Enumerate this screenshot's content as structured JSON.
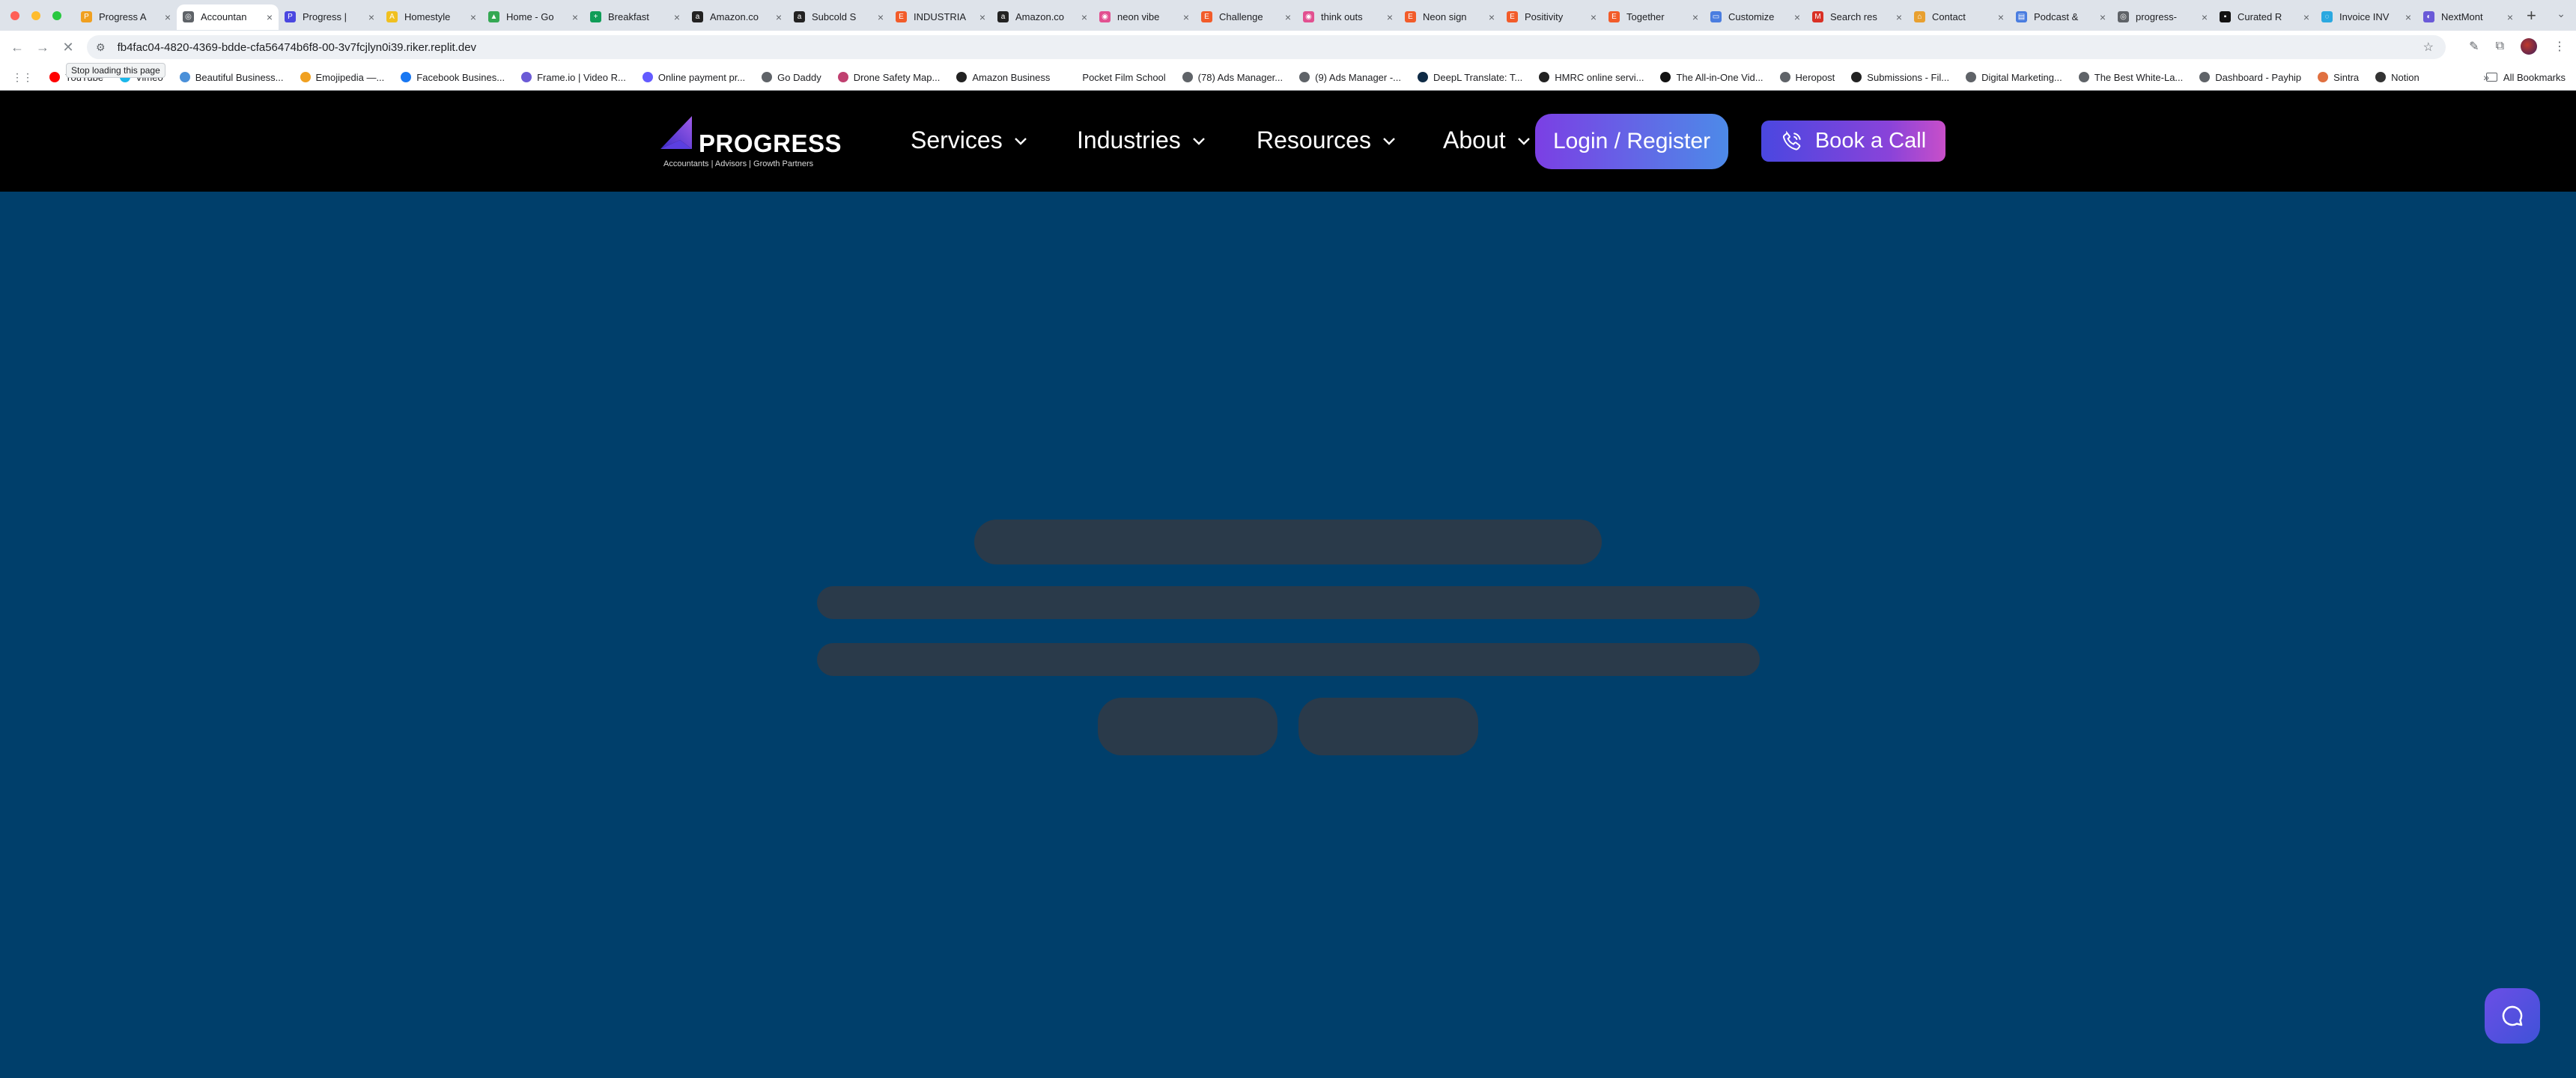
{
  "browser": {
    "tabs": [
      {
        "title": "Progress A",
        "color": "#f0a020",
        "glyph": "P"
      },
      {
        "title": "Accountan",
        "color": "#5f6368",
        "glyph": "◎",
        "active": true
      },
      {
        "title": "Progress |",
        "color": "#4a47e0",
        "glyph": "P"
      },
      {
        "title": "Homestyle",
        "color": "#f0c020",
        "glyph": "A"
      },
      {
        "title": "Home - Go",
        "color": "#34a853",
        "glyph": "▲"
      },
      {
        "title": "Breakfast",
        "color": "#0f9d58",
        "glyph": "+"
      },
      {
        "title": "Amazon.co",
        "color": "#222222",
        "glyph": "a"
      },
      {
        "title": "Subcold S",
        "color": "#222222",
        "glyph": "a"
      },
      {
        "title": "INDUSTRIA",
        "color": "#f25c2a",
        "glyph": "E"
      },
      {
        "title": "Amazon.co",
        "color": "#222222",
        "glyph": "a"
      },
      {
        "title": "neon vibe",
        "color": "#e25090",
        "glyph": "◉"
      },
      {
        "title": "Challenge",
        "color": "#f25c2a",
        "glyph": "E"
      },
      {
        "title": "think outs",
        "color": "#e25090",
        "glyph": "◉"
      },
      {
        "title": "Neon sign",
        "color": "#f25c2a",
        "glyph": "E"
      },
      {
        "title": "Positivity",
        "color": "#f25c2a",
        "glyph": "E"
      },
      {
        "title": "Together",
        "color": "#f25c2a",
        "glyph": "E"
      },
      {
        "title": "Customize",
        "color": "#4a7de0",
        "glyph": "▭"
      },
      {
        "title": "Search res",
        "color": "#d93025",
        "glyph": "M"
      },
      {
        "title": "Contact",
        "color": "#e8a030",
        "glyph": "⌂"
      },
      {
        "title": "Podcast &",
        "color": "#4a7de0",
        "glyph": "▤"
      },
      {
        "title": "progress-",
        "color": "#5f6368",
        "glyph": "◎"
      },
      {
        "title": "Curated R",
        "color": "#111111",
        "glyph": "▪"
      },
      {
        "title": "Invoice INV",
        "color": "#2aa8e0",
        "glyph": "◌"
      },
      {
        "title": "NextMont",
        "color": "#6a5ad8",
        "glyph": "◐"
      }
    ],
    "url": "fb4fac04-4820-4369-bdde-cfa56474b6f8-00-3v7fcjlyn0i39.riker.replit.dev",
    "tooltip": "Stop loading this page",
    "bookmarks": [
      {
        "label": "YouTube",
        "color": "#ff0000"
      },
      {
        "label": "Vimeo",
        "color": "#1ab7ea"
      },
      {
        "label": "Beautiful Business...",
        "color": "#4a90d9"
      },
      {
        "label": "Emojipedia —...",
        "color": "#f0a020"
      },
      {
        "label": "Facebook Busines...",
        "color": "#1877f2"
      },
      {
        "label": "Frame.io | Video R...",
        "color": "#6b5bd6"
      },
      {
        "label": "Online payment pr...",
        "color": "#635bff"
      },
      {
        "label": "Go Daddy",
        "color": "#5f6368"
      },
      {
        "label": "Drone Safety Map...",
        "color": "#c04070"
      },
      {
        "label": "Amazon Business",
        "color": "#222222"
      },
      {
        "label": "Pocket Film School",
        "color": "#ffffff"
      },
      {
        "label": "(78) Ads Manager...",
        "color": "#5f6368"
      },
      {
        "label": "(9) Ads Manager -...",
        "color": "#5f6368"
      },
      {
        "label": "DeepL Translate: T...",
        "color": "#0f2b46"
      },
      {
        "label": "HMRC online servi...",
        "color": "#222222"
      },
      {
        "label": "The All-in-One Vid...",
        "color": "#111111"
      },
      {
        "label": "Heropost",
        "color": "#5f6368"
      },
      {
        "label": "Submissions - Fil...",
        "color": "#222222"
      },
      {
        "label": "Digital Marketing...",
        "color": "#5f6368"
      },
      {
        "label": "The Best White-La...",
        "color": "#5f6368"
      },
      {
        "label": "Dashboard - Payhip",
        "color": "#5f6368"
      },
      {
        "label": "Sintra",
        "color": "#e07040"
      },
      {
        "label": "Notion",
        "color": "#333333"
      }
    ],
    "all_bookmarks": "All Bookmarks"
  },
  "site": {
    "brand": "PROGRESS",
    "tagline": "Accountants | Advisors | Growth Partners",
    "nav": [
      "Services",
      "Industries",
      "Resources",
      "About"
    ],
    "login_label": "Login / Register",
    "call_label": "Book a Call",
    "colors": {
      "background": "#003f6b",
      "header": "#000000",
      "skeleton": "#2a3a4a"
    }
  }
}
